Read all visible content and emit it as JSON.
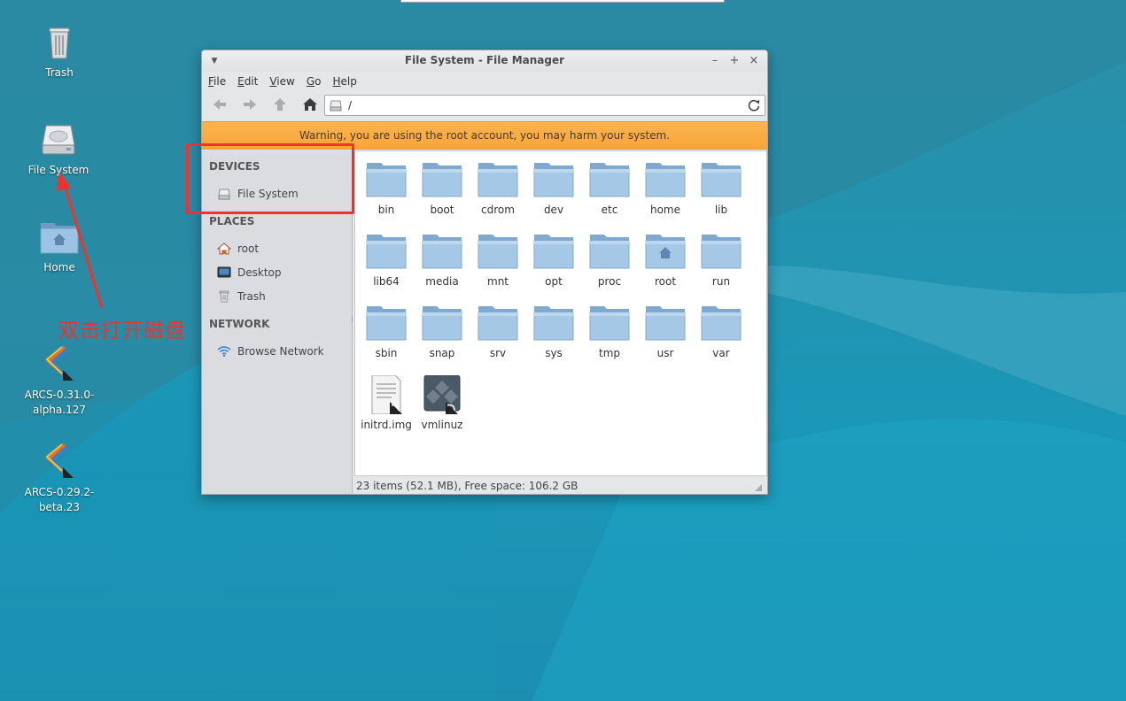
{
  "desktop": {
    "icons": [
      {
        "label": "Trash",
        "icon": "trash-icon"
      },
      {
        "label": "File System",
        "icon": "drive-icon"
      },
      {
        "label": "Home",
        "icon": "home-folder-icon"
      },
      {
        "label": "ARCS-0.31.0-\nalpha.127",
        "icon": "arcs-app-icon"
      },
      {
        "label": "ARCS-0.29.2-\nbeta.23",
        "icon": "arcs-app-icon"
      }
    ]
  },
  "annotation": {
    "text": "双击打开磁盘",
    "color": "#f2312b"
  },
  "window": {
    "title": "File System - File Manager",
    "controls": {
      "minimize": "–",
      "maximize": "+",
      "close": "×"
    },
    "menu": [
      "File",
      "Edit",
      "View",
      "Go",
      "Help"
    ],
    "menu_mnemonics": [
      "F",
      "E",
      "V",
      "G",
      "H"
    ],
    "path": "/",
    "warning": "Warning, you are using the root account, you may harm your system.",
    "sidebar": {
      "devices_heading": "DEVICES",
      "devices": [
        {
          "label": "File System",
          "icon": "drive-icon"
        }
      ],
      "places_heading": "PLACES",
      "places": [
        {
          "label": "root",
          "icon": "home-icon"
        },
        {
          "label": "Desktop",
          "icon": "desktop-icon"
        },
        {
          "label": "Trash",
          "icon": "trash-icon"
        }
      ],
      "network_heading": "NETWORK",
      "network": [
        {
          "label": "Browse Network",
          "icon": "wifi-icon"
        }
      ]
    },
    "files": [
      {
        "name": "bin",
        "type": "folder"
      },
      {
        "name": "boot",
        "type": "folder"
      },
      {
        "name": "cdrom",
        "type": "folder"
      },
      {
        "name": "dev",
        "type": "folder"
      },
      {
        "name": "etc",
        "type": "folder"
      },
      {
        "name": "home",
        "type": "folder"
      },
      {
        "name": "lib",
        "type": "folder"
      },
      {
        "name": "lib64",
        "type": "folder"
      },
      {
        "name": "media",
        "type": "folder"
      },
      {
        "name": "mnt",
        "type": "folder"
      },
      {
        "name": "opt",
        "type": "folder"
      },
      {
        "name": "proc",
        "type": "folder"
      },
      {
        "name": "root",
        "type": "home-folder"
      },
      {
        "name": "run",
        "type": "folder"
      },
      {
        "name": "sbin",
        "type": "folder"
      },
      {
        "name": "snap",
        "type": "folder"
      },
      {
        "name": "srv",
        "type": "folder"
      },
      {
        "name": "sys",
        "type": "folder"
      },
      {
        "name": "tmp",
        "type": "folder"
      },
      {
        "name": "usr",
        "type": "folder"
      },
      {
        "name": "var",
        "type": "folder"
      },
      {
        "name": "initrd.img",
        "type": "doc-link"
      },
      {
        "name": "vmlinuz",
        "type": "bin-link"
      }
    ],
    "status": "23 items (52.1 MB), Free space: 106.2 GB"
  },
  "colors": {
    "desktop": "#1f8eab",
    "warning_bar": "#f9aa40",
    "folder": "#8fb9dc",
    "annotation": "#f2312b"
  }
}
